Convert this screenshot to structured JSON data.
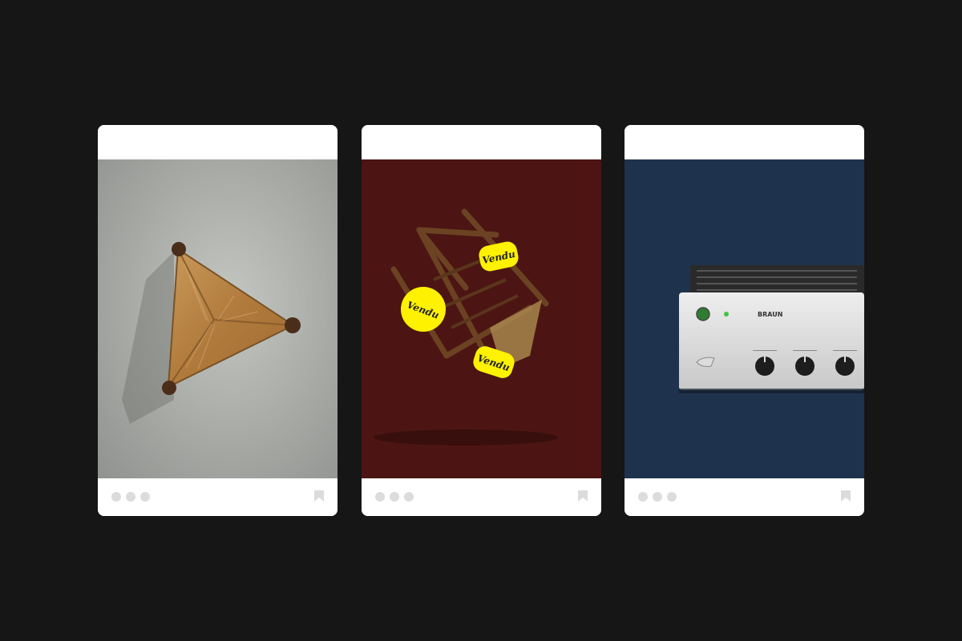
{
  "colors": {
    "page_background": "#161616",
    "card_background": "#ffffff",
    "footer_icon": "#dcdcdc",
    "sticker_yellow": "#fff200"
  },
  "cards": [
    {
      "image_subject": "rush-seat-triangular-stool",
      "image_background": "#9a9d99",
      "footer": {
        "more_icon": "three-dots-icon",
        "bookmark_icon": "bookmark-icon"
      }
    },
    {
      "image_subject": "wooden-chair-with-stickers",
      "image_background": "#4c1513",
      "stickers": [
        "Vendu",
        "Vendu",
        "Vendu"
      ],
      "footer": {
        "more_icon": "three-dots-icon",
        "bookmark_icon": "bookmark-icon"
      }
    },
    {
      "image_subject": "braun-amplifier",
      "image_background": "#1f324d",
      "brand_text": "BRAUN",
      "footer": {
        "more_icon": "three-dots-icon",
        "bookmark_icon": "bookmark-icon"
      }
    }
  ]
}
